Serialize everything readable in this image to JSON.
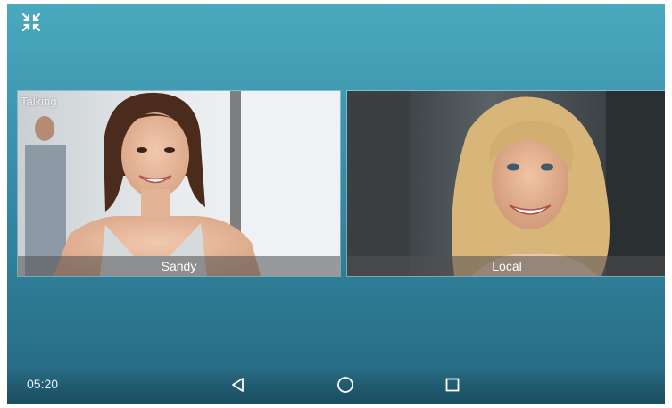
{
  "status": {
    "clock": "05:20"
  },
  "toolbar": {
    "collapse_icon": "collapse-arrows-icon"
  },
  "participants": [
    {
      "name": "Sandy",
      "state": "Talking"
    },
    {
      "name": "Local"
    }
  ],
  "navbar": {
    "back_icon": "back-triangle-icon",
    "home_icon": "home-circle-icon",
    "recents_icon": "recents-square-icon"
  },
  "colors": {
    "background_top": "#4aa9be",
    "background_bottom": "#25677f",
    "name_bar": "#505050"
  }
}
